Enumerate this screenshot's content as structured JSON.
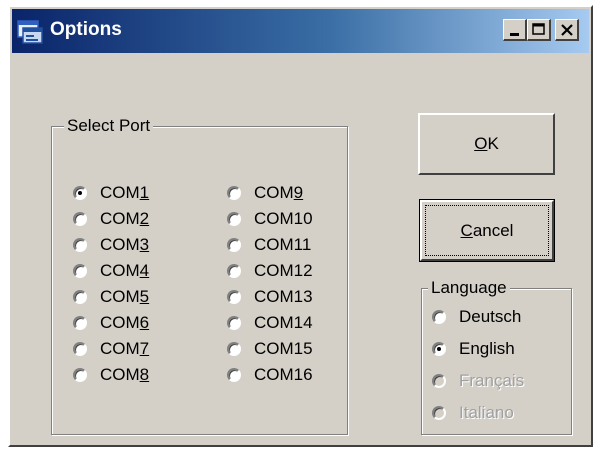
{
  "window": {
    "title": "Options",
    "controls": {
      "minimize": "minimize",
      "maximize": "maximize",
      "close": "close"
    }
  },
  "port_group": {
    "label": "Select Port",
    "selected": "COM1",
    "ports": [
      {
        "prefix": "COM",
        "accel": "1",
        "suffix": "",
        "checked": true
      },
      {
        "prefix": "COM",
        "accel": "2",
        "suffix": "",
        "checked": false
      },
      {
        "prefix": "COM",
        "accel": "3",
        "suffix": "",
        "checked": false
      },
      {
        "prefix": "COM",
        "accel": "4",
        "suffix": "",
        "checked": false
      },
      {
        "prefix": "COM",
        "accel": "5",
        "suffix": "",
        "checked": false
      },
      {
        "prefix": "COM",
        "accel": "6",
        "suffix": "",
        "checked": false
      },
      {
        "prefix": "COM",
        "accel": "7",
        "suffix": "",
        "checked": false
      },
      {
        "prefix": "COM",
        "accel": "8",
        "suffix": "",
        "checked": false
      },
      {
        "prefix": "COM",
        "accel": "9",
        "suffix": "",
        "checked": false
      },
      {
        "prefix": "COM10",
        "accel": "",
        "suffix": "",
        "checked": false
      },
      {
        "prefix": "COM11",
        "accel": "",
        "suffix": "",
        "checked": false
      },
      {
        "prefix": "COM12",
        "accel": "",
        "suffix": "",
        "checked": false
      },
      {
        "prefix": "COM13",
        "accel": "",
        "suffix": "",
        "checked": false
      },
      {
        "prefix": "COM14",
        "accel": "",
        "suffix": "",
        "checked": false
      },
      {
        "prefix": "COM15",
        "accel": "",
        "suffix": "",
        "checked": false
      },
      {
        "prefix": "COM16",
        "accel": "",
        "suffix": "",
        "checked": false
      }
    ]
  },
  "buttons": {
    "ok": {
      "accel": "O",
      "rest": "K"
    },
    "cancel": {
      "accel": "C",
      "rest": "ancel"
    }
  },
  "language_group": {
    "label": "Language",
    "selected": "English",
    "options": [
      {
        "label": "Deutsch",
        "checked": false,
        "enabled": true
      },
      {
        "label": "English",
        "checked": true,
        "enabled": true
      },
      {
        "label": "Français",
        "checked": false,
        "enabled": false
      },
      {
        "label": "Italiano",
        "checked": false,
        "enabled": false
      }
    ]
  },
  "icons": {
    "title": "app-window-icon"
  },
  "colors": {
    "titlebar_start": "#0a246a",
    "titlebar_end": "#a6caf0",
    "face": "#d4d0c8"
  }
}
